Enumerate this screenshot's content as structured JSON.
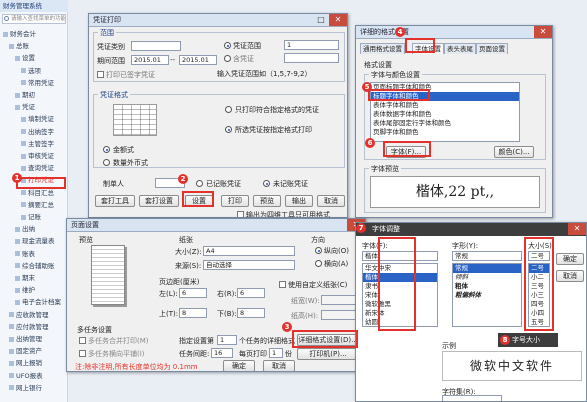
{
  "app": {
    "title": "财务管理系统",
    "search_placeholder": "请输入查找菜单的功能"
  },
  "sidebar": {
    "items": [
      {
        "label": "财务会计",
        "level": 0
      },
      {
        "label": "总账",
        "level": 1
      },
      {
        "label": "设置",
        "level": 2
      },
      {
        "label": "选项",
        "level": 3
      },
      {
        "label": "常用凭证",
        "level": 3
      },
      {
        "label": "期初",
        "level": 2
      },
      {
        "label": "凭证",
        "level": 2
      },
      {
        "label": "填制凭证",
        "level": 3
      },
      {
        "label": "出纳签字",
        "level": 3
      },
      {
        "label": "主管签字",
        "level": 3
      },
      {
        "label": "审核凭证",
        "level": 3
      },
      {
        "label": "查询凭证",
        "level": 3
      },
      {
        "label": "打印凭证",
        "level": 3,
        "active": true
      },
      {
        "label": "科目汇总",
        "level": 3
      },
      {
        "label": "摘要汇总",
        "level": 3
      },
      {
        "label": "记账",
        "level": 3
      },
      {
        "label": "出纳",
        "level": 2
      },
      {
        "label": "现金流量表",
        "level": 2
      },
      {
        "label": "账表",
        "level": 2
      },
      {
        "label": "综合辅助账",
        "level": 2
      },
      {
        "label": "期末",
        "level": 2
      },
      {
        "label": "维护",
        "level": 2
      },
      {
        "label": "电子会计档案",
        "level": 2
      },
      {
        "label": "应收款管理",
        "level": 1
      },
      {
        "label": "应付款管理",
        "level": 1
      },
      {
        "label": "出纳管理",
        "level": 1
      },
      {
        "label": "固定资产",
        "level": 1
      },
      {
        "label": "网上报销",
        "level": 1
      },
      {
        "label": "UFO报表",
        "level": 1
      },
      {
        "label": "网上银行",
        "level": 1
      }
    ]
  },
  "print_dialog": {
    "title": "凭证打印",
    "range_group": "范围",
    "voucher_type_label": "凭证类别",
    "period_label": "期间范围",
    "period_from": "2015.01",
    "period_to": "2015.01",
    "period_sep": "--",
    "voucher_range_label": "凭证范围",
    "voucher_range_value": "1",
    "include_label": "含凭证",
    "printed_filter_label": "打印已签字凭证",
    "range_hint": "输入凭证范围如（1,5,7-9,2）",
    "format_group": "凭证格式",
    "amount_label": "金额式",
    "quantity_label": "数量外币式",
    "opt_only_match": "只打印符合指定格式的凭证",
    "opt_by_format": "所选凭证按指定格式打印",
    "maker_label": "制单人",
    "opt_recorded": "已记账凭证",
    "opt_unrecorded": "未记账凭证",
    "buttons": [
      "套打工具",
      "套打设置",
      "设置",
      "打印",
      "预览",
      "输出",
      "取消"
    ],
    "footer_check": "输出为四维工具只可用格式"
  },
  "detail_dialog": {
    "title": "详细的格式设置",
    "tabs": [
      "通用格式设置",
      "字体设置",
      "表头表尾",
      "页面设置"
    ],
    "format_group": "格式设置",
    "font_group": "字体与颜色设置",
    "list_items": [
      "页面标题字体和颜色",
      "标题字体和颜色",
      "表体字体和颜色",
      "表体数据字体和颜色",
      "表体尾部固定行字体和颜色",
      "页脚字体和颜色"
    ],
    "font_button": "字体(F)...",
    "color_button": "颜色(C)...",
    "preview_group": "字体预览",
    "preview_text": "楷体,22 pt,,",
    "ok": "确定",
    "cancel": "取消"
  },
  "page_dialog": {
    "title": "页面设置",
    "preview_label": "预览",
    "paper_group": "纸张",
    "size_label": "大小(Z):",
    "size_value": "A4",
    "source_label": "来源(S):",
    "source_value": "自动选择",
    "orient_group": "方向",
    "portrait": "纵向(O)",
    "landscape": "横向(A)",
    "margins_group": "页边距(厘米)",
    "left_label": "左(L):",
    "left_value": "6",
    "right_label": "右(R):",
    "right_value": "6",
    "top_label": "上(T):",
    "top_value": "8",
    "bottom_label": "下(B):",
    "bottom_value": "8",
    "custom_paper_label": "使用自定义纸张(C)",
    "width_label": "纸宽(W):",
    "height_label": "纸高(H):",
    "multi_group": "多任务设置",
    "multi_print": "多任务合并打印(M)",
    "multi_preview": "多任务横向平铺(I)",
    "spec_label": "指定设置第",
    "spec_value": "1",
    "spec_suffix": "个任务的详细格式",
    "tasks_label": "任务间距:",
    "tasks_value": "16",
    "pages_label": "每页打印",
    "pages_value": "1",
    "pages_suffix": "份",
    "detail_button": "详细格式设置(D)...",
    "printer_button": "打印机(P)...",
    "note": "注:除非注明,所有长度单位均为 0.1mm",
    "ok": "确定",
    "cancel": "取消"
  },
  "font_dialog": {
    "title": "字体调整",
    "font_label": "字体(F):",
    "font_value": "楷体",
    "fonts": [
      "华文中宋",
      "楷体",
      "隶书",
      "宋体",
      "微软雅黑",
      "新宋体",
      "幼圆"
    ],
    "style_label": "字形(Y):",
    "style_value": "常规",
    "styles": [
      "常规",
      "倾斜",
      "粗体",
      "粗偏斜体"
    ],
    "size_label": "大小(S):",
    "size_value": "二号",
    "sizes": [
      "二号",
      "小二",
      "三号",
      "小三",
      "四号",
      "小四",
      "五号"
    ],
    "ok": "确定",
    "cancel": "取消",
    "sample_label": "示例",
    "sample_text": "微软中文软件",
    "script_label": "字符集(R):",
    "size_callout": "字号大小"
  },
  "badges": [
    "1",
    "2",
    "3",
    "4",
    "5",
    "6",
    "7",
    "8"
  ],
  "colors": {
    "accent": "#e3322b",
    "selection": "#2a63c6",
    "title_bar": "#d8e4f2"
  }
}
